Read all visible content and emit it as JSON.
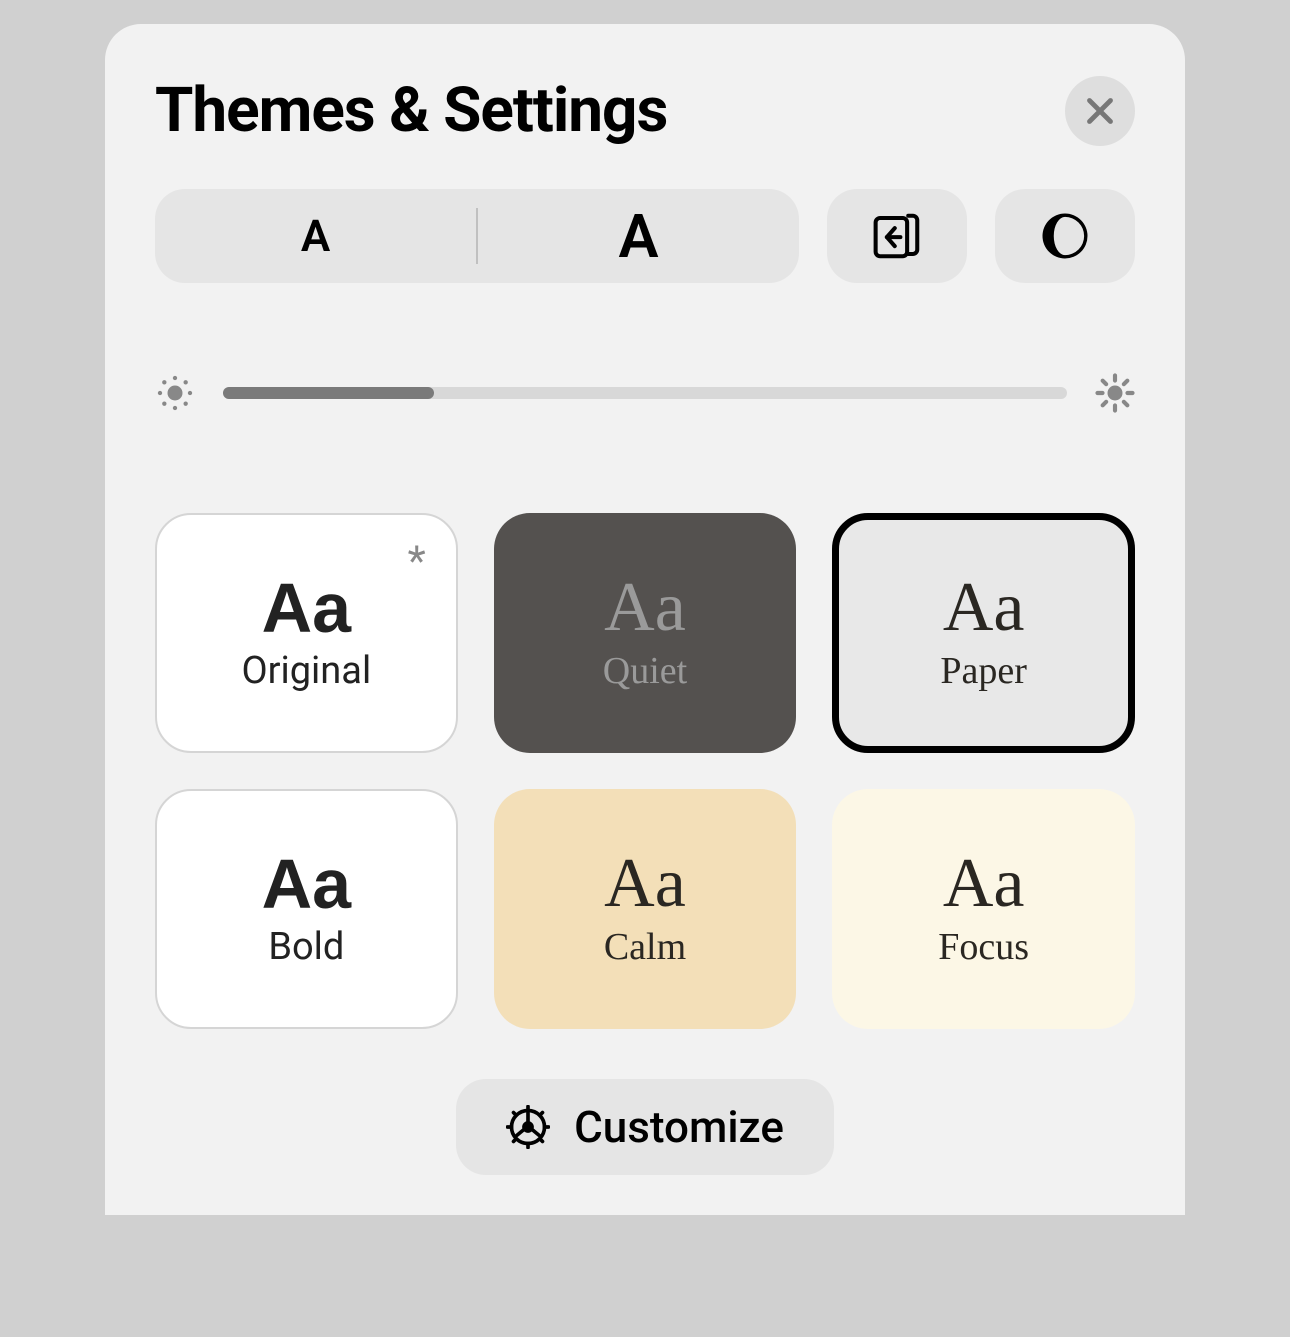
{
  "header": {
    "title": "Themes & Settings"
  },
  "fontSize": {
    "small": "A",
    "large": "A"
  },
  "brightness": {
    "value": 25
  },
  "themes": [
    {
      "sample": "Aa",
      "label": "Original",
      "key": "original",
      "asterisk": "*"
    },
    {
      "sample": "Aa",
      "label": "Quiet",
      "key": "quiet"
    },
    {
      "sample": "Aa",
      "label": "Paper",
      "key": "paper",
      "selected": true
    },
    {
      "sample": "Aa",
      "label": "Bold",
      "key": "bold"
    },
    {
      "sample": "Aa",
      "label": "Calm",
      "key": "calm"
    },
    {
      "sample": "Aa",
      "label": "Focus",
      "key": "focus"
    }
  ],
  "customize": {
    "label": "Customize"
  }
}
